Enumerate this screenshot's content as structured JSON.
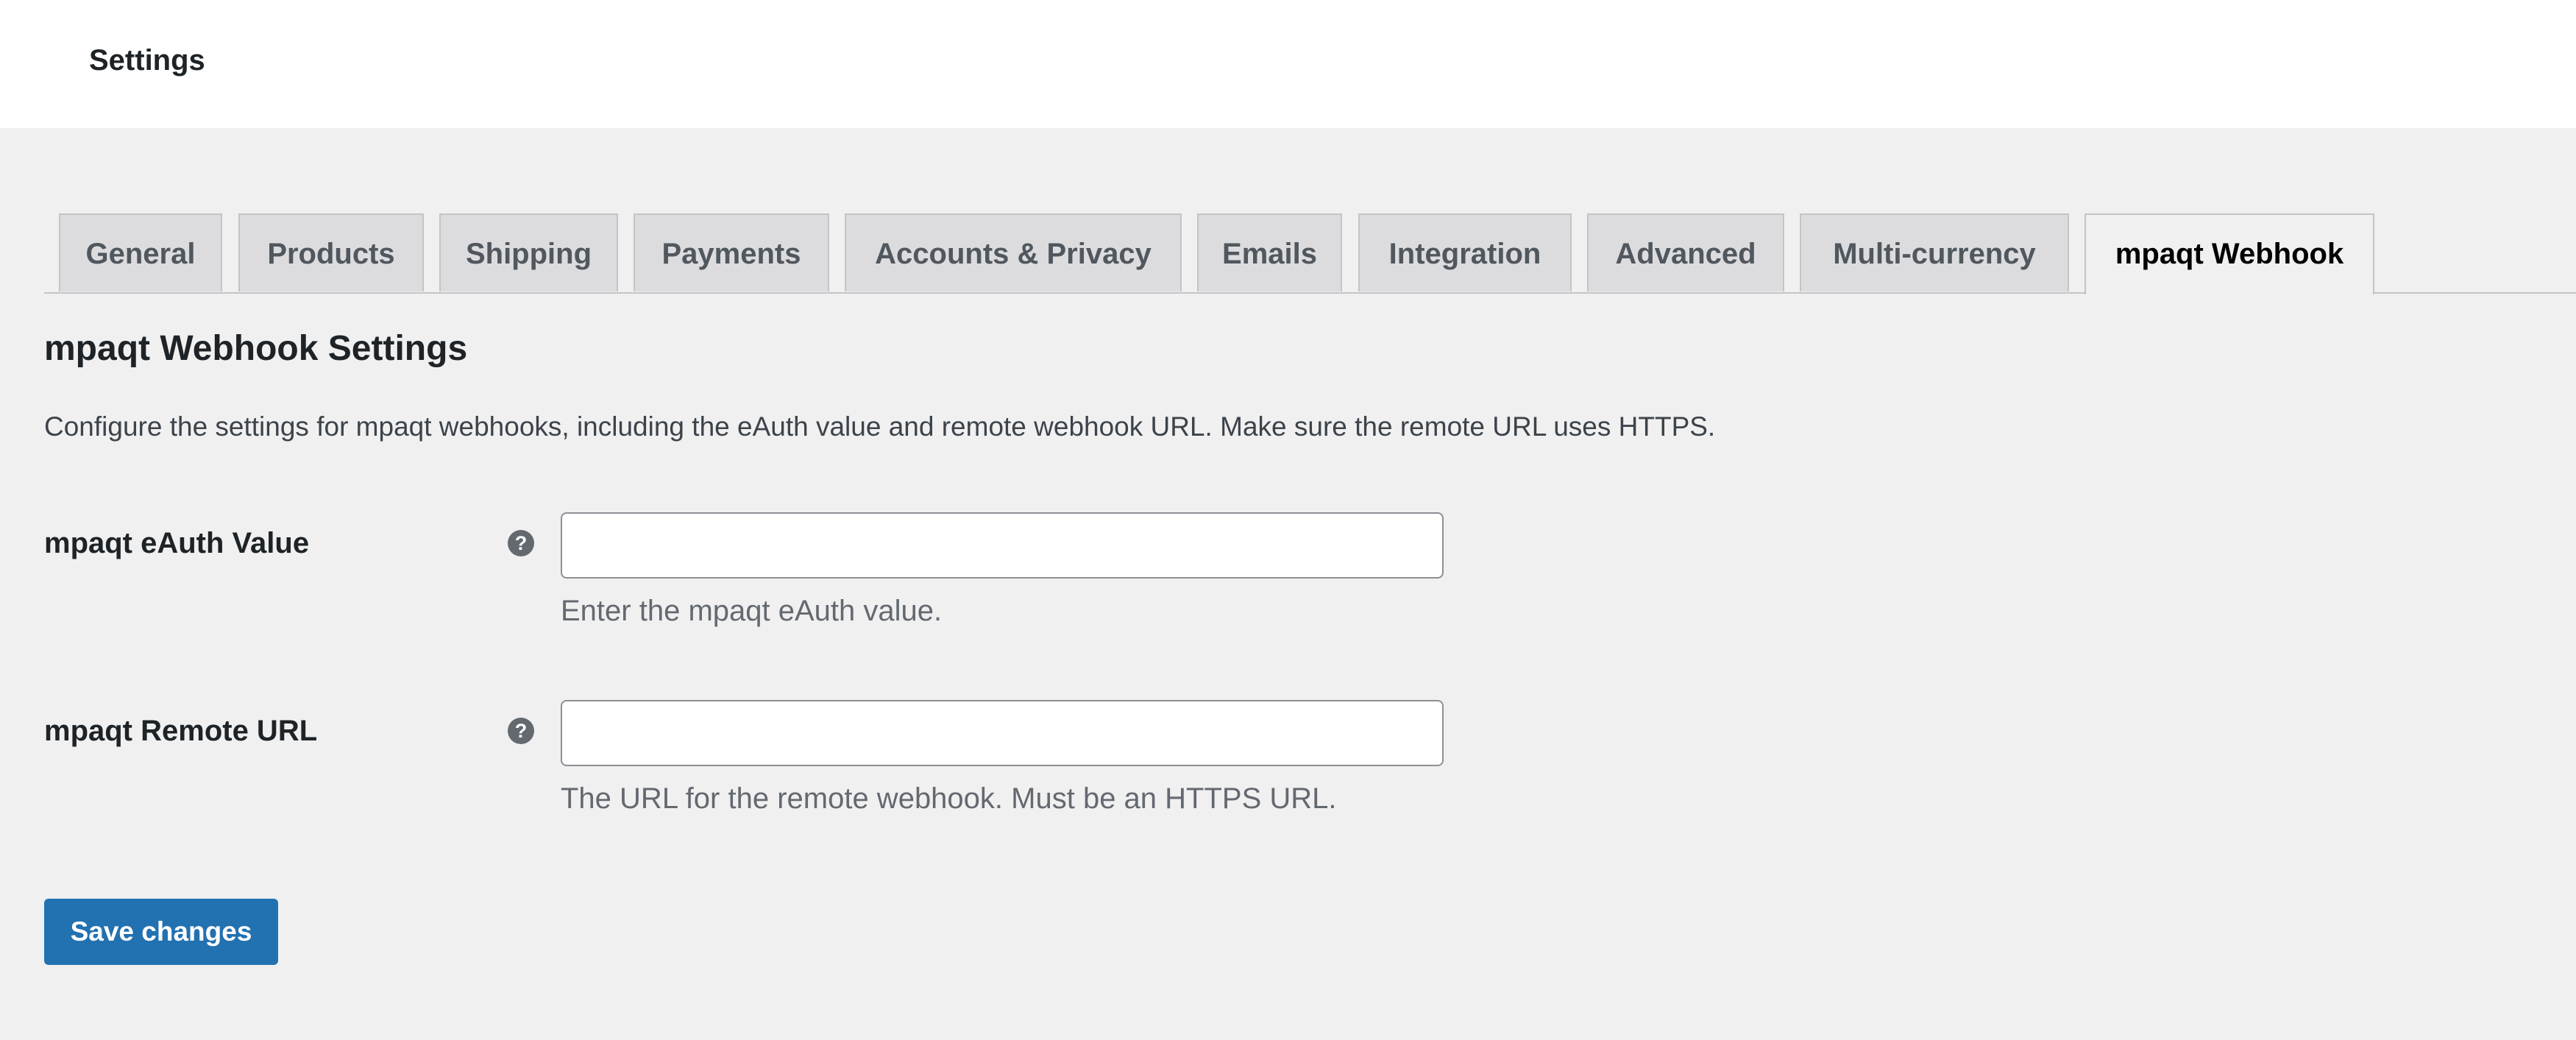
{
  "header": {
    "title": "Settings"
  },
  "tabs": [
    {
      "label": "General"
    },
    {
      "label": "Products"
    },
    {
      "label": "Shipping"
    },
    {
      "label": "Payments"
    },
    {
      "label": "Accounts & Privacy"
    },
    {
      "label": "Emails"
    },
    {
      "label": "Integration"
    },
    {
      "label": "Advanced"
    },
    {
      "label": "Multi-currency"
    },
    {
      "label": "mpaqt Webhook",
      "active": true
    }
  ],
  "section": {
    "title": "mpaqt Webhook Settings",
    "description": "Configure the settings for mpaqt webhooks, including the eAuth value and remote webhook URL. Make sure the remote URL uses HTTPS."
  },
  "fields": [
    {
      "label": "mpaqt eAuth Value",
      "help_icon": "question-mark-icon",
      "value": "",
      "description": "Enter the mpaqt eAuth value."
    },
    {
      "label": "mpaqt Remote URL",
      "help_icon": "question-mark-icon",
      "value": "",
      "description": "The URL for the remote webhook. Must be an HTTPS URL."
    }
  ],
  "actions": {
    "save_label": "Save changes"
  },
  "colors": {
    "primary_button": "#2271b1",
    "tab_inactive_bg": "#dcdcde",
    "page_bg": "#f0f0f1"
  }
}
